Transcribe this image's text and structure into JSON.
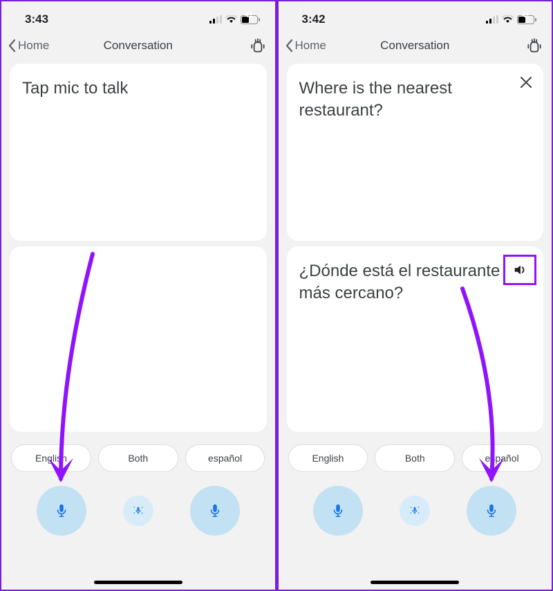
{
  "left": {
    "status": {
      "time": "3:43",
      "battery": "41"
    },
    "nav": {
      "back_label": "Home",
      "title": "Conversation"
    },
    "card_top": {
      "text": "Tap mic to talk"
    },
    "card_bottom": {
      "text": ""
    },
    "chips": {
      "lang1": "English",
      "both": "Both",
      "lang2": "español"
    }
  },
  "right": {
    "status": {
      "time": "3:42",
      "battery": "41"
    },
    "nav": {
      "back_label": "Home",
      "title": "Conversation"
    },
    "card_top": {
      "text": "Where is the nearest restaurant?"
    },
    "card_bottom": {
      "text": "¿Dónde está el restaurante más cercano?"
    },
    "chips": {
      "lang1": "English",
      "both": "Both",
      "lang2": "español"
    }
  },
  "colors": {
    "accent": "#9013fe",
    "mic_bg": "#c2e1f3"
  }
}
